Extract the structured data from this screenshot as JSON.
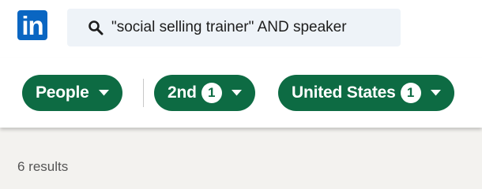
{
  "header": {
    "logo_text": "in",
    "search": {
      "query": "\"social selling trainer\" AND speaker",
      "icon": "search-icon"
    }
  },
  "filters": [
    {
      "label": "People",
      "count": null,
      "icon": "caret-down-icon"
    },
    {
      "label": "2nd",
      "count": "1",
      "icon": "caret-down-icon"
    },
    {
      "label": "United States",
      "count": "1",
      "icon": "caret-down-icon"
    }
  ],
  "results": {
    "summary": "6 results"
  },
  "colors": {
    "brand": "#0a66c2",
    "filter_active": "#0d6b43",
    "search_bg": "#eef3f8",
    "page_bg": "#f3f2ef"
  }
}
